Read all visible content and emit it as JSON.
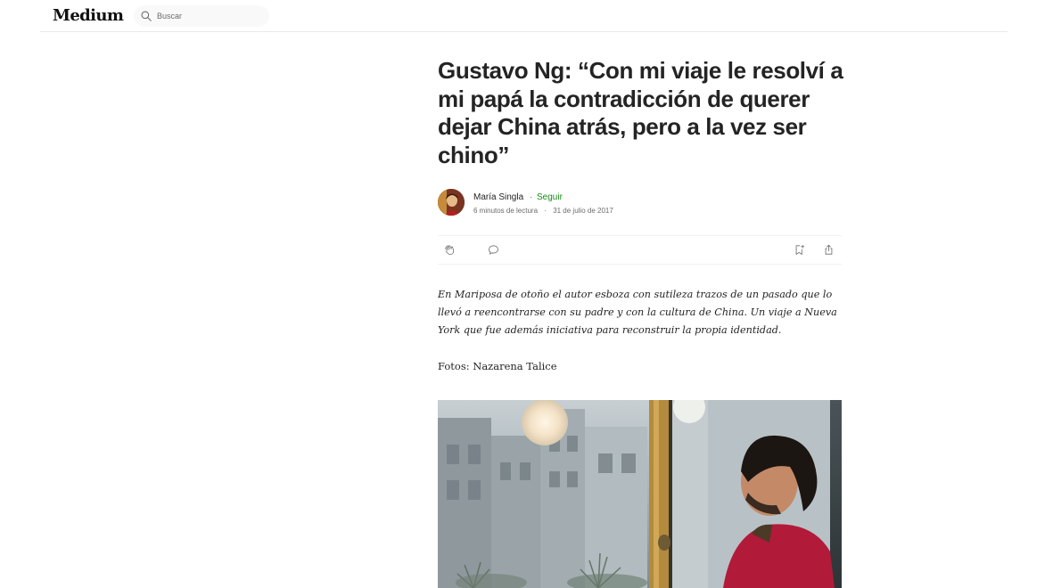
{
  "header": {
    "logo": "Medium",
    "search_placeholder": "Buscar"
  },
  "article": {
    "title": "Gustavo Ng: “Con mi viaje le resolví a mi papá la contradicción de querer dejar China atrás, pero a la vez ser chino”",
    "author": "María Singla",
    "separator": "·",
    "follow_label": "Seguir",
    "read_time": "6 minutos de lectura",
    "date": "31 de julio de 2017",
    "lead": "En Mariposa de otoño el autor esboza con sutileza trazos de un pasado que lo llevó a reencontrarse con su padre y con la cultura de China. Un viaje a Nueva York que fue además iniciativa para reconstruir la propia identidad.",
    "photo_credit": "Fotos: Nazarena Talice"
  },
  "icons": {
    "search": "search-icon",
    "clap": "clap-icon",
    "comment": "comment-icon",
    "save": "bookmark-add-icon",
    "share": "share-icon"
  },
  "colors": {
    "follow": "#1a8917",
    "text": "#242424",
    "muted": "#6b6b6b"
  }
}
